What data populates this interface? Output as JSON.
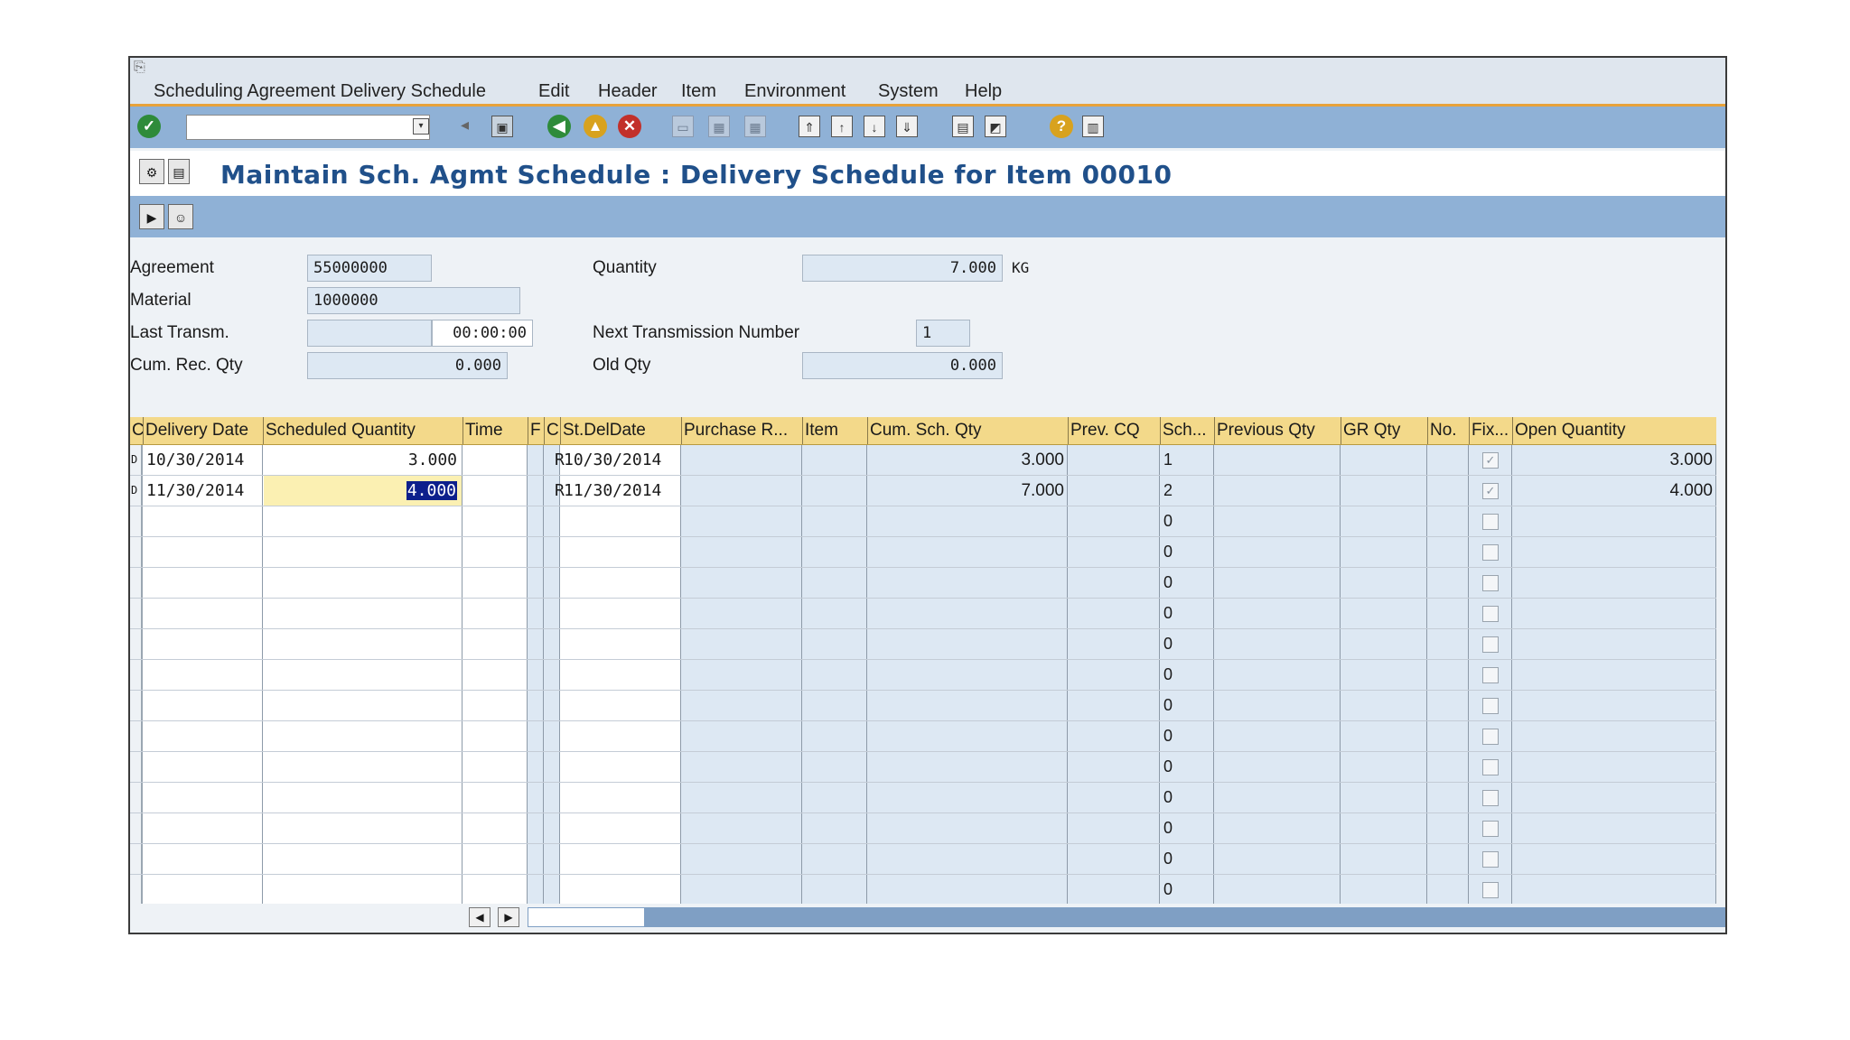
{
  "menu": [
    "Scheduling Agreement Delivery Schedule",
    "Edit",
    "Header",
    "Item",
    "Environment",
    "System",
    "Help"
  ],
  "title": "Maintain Sch. Agmt Schedule : Delivery Schedule for Item 00010",
  "header": {
    "agreement_label": "Agreement",
    "agreement_value": "55000000",
    "material_label": "Material",
    "material_value": "1000000",
    "last_transm_label": "Last Transm.",
    "last_transm_time": "00:00:00",
    "cum_rec_label": "Cum. Rec. Qty",
    "cum_rec_value": "0.000",
    "quantity_label": "Quantity",
    "quantity_value": "7.000",
    "quantity_unit": "KG",
    "next_trans_label": "Next Transmission Number",
    "next_trans_value": "1",
    "old_qty_label": "Old Qty",
    "old_qty_value": "0.000"
  },
  "table": {
    "columns": [
      "C",
      "Delivery Date",
      "Scheduled Quantity",
      "Time",
      "F",
      "C",
      "St.DelDate",
      "Purchase R...",
      "Item",
      "Cum. Sch. Qty",
      "Prev. CQ",
      "Sch...",
      "Previous Qty",
      "GR Qty",
      "No.",
      "Fix...",
      "Open Quantity"
    ],
    "rows": [
      {
        "c": "D",
        "delivery_date": "10/30/2014",
        "sched_qty": "3.000",
        "cat": "R",
        "st_del_date": "10/30/2014",
        "cum_sch_qty": "3.000",
        "sch": "1",
        "fix": true,
        "open_qty": "3.000"
      },
      {
        "c": "D",
        "delivery_date": "11/30/2014",
        "sched_qty": "4.000",
        "cat": "R",
        "st_del_date": "11/30/2014",
        "cum_sch_qty": "7.000",
        "sch": "2",
        "fix": true,
        "open_qty": "4.000"
      }
    ],
    "empty_sch_value": "0"
  },
  "colors": {
    "toolbar": "#8fb1d6",
    "header_row": "#f3d98a",
    "title": "#20508a",
    "selection": "#0c1f8c"
  }
}
